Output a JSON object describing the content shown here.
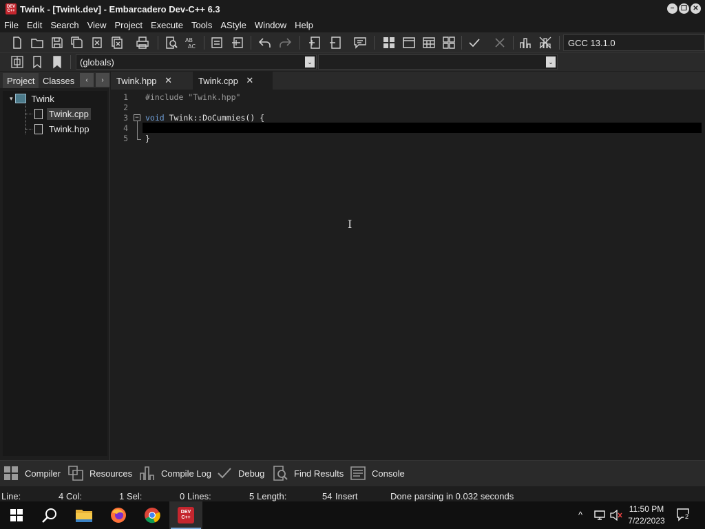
{
  "window": {
    "title": "Twink - [Twink.dev] - Embarcadero Dev-C++ 6.3",
    "app_icon_text": "DEV C++",
    "minimize": "−",
    "restore": "❐",
    "close": "✕"
  },
  "menu": [
    "File",
    "Edit",
    "Search",
    "View",
    "Project",
    "Execute",
    "Tools",
    "AStyle",
    "Window",
    "Help"
  ],
  "toolbar": {
    "compiler": "GCC 13.1.0",
    "scope": "(globals)",
    "member": "",
    "dropdown_arrow": "⌄"
  },
  "left_panel": {
    "tabs": [
      "Project",
      "Classes"
    ],
    "prev": "‹",
    "next": "›",
    "tree": {
      "project": "Twink",
      "expander": "▾",
      "files": [
        "Twink.cpp",
        "Twink.hpp"
      ]
    }
  },
  "editor": {
    "tabs": [
      {
        "label": "Twink.hpp",
        "close": "✕"
      },
      {
        "label": "Twink.cpp",
        "close": "✕"
      }
    ],
    "fold": "−",
    "lines": [
      {
        "num": "1",
        "parts": [
          {
            "text": "#include \"Twink.hpp\"",
            "kind": "directive"
          }
        ]
      },
      {
        "num": "2",
        "parts": []
      },
      {
        "num": "3",
        "parts": [
          {
            "text": "void",
            "kind": "keyword"
          },
          {
            "text": " Twink::DoCummies() {",
            "kind": "plain"
          }
        ]
      },
      {
        "num": "4",
        "parts": []
      },
      {
        "num": "5",
        "parts": [
          {
            "text": "}",
            "kind": "plain"
          }
        ]
      }
    ],
    "text_cursor": "I"
  },
  "bottom_tabs": [
    "Compiler",
    "Resources",
    "Compile Log",
    "Debug",
    "Find Results",
    "Console"
  ],
  "status": {
    "line_label": "Line:",
    "line_value": "4",
    "col_label": "Col:",
    "col_value": "1",
    "sel_label": "Sel:",
    "sel_value": "0",
    "lines_label": "Lines:",
    "lines_value": "5",
    "length_label": "Length:",
    "length_value": "54",
    "mode": "Insert",
    "message": "Done parsing in 0.032 seconds"
  },
  "taskbar": {
    "apps": [
      "start",
      "search",
      "file-explorer",
      "firefox",
      "chrome",
      "devcpp"
    ],
    "devcpp_text": "DEV C++",
    "time": "11:50 PM",
    "date": "7/22/2023",
    "notification_count": "2",
    "tray_chevron": "^"
  }
}
